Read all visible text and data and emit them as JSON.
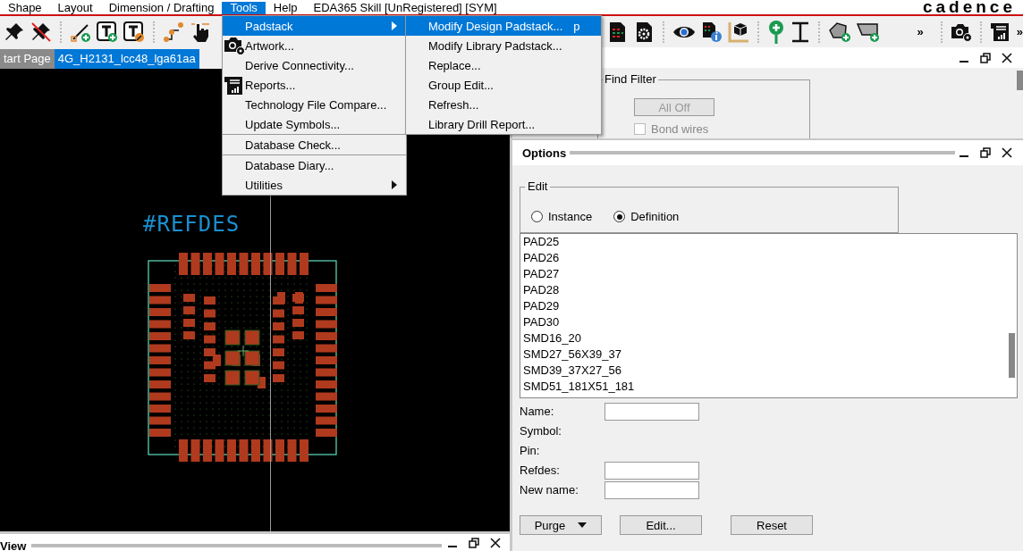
{
  "menubar": {
    "items": [
      {
        "label": "Shape",
        "selected": false
      },
      {
        "label": "Layout",
        "selected": false
      },
      {
        "label": "Dimension / Drafting",
        "selected": false
      },
      {
        "label": "Tools",
        "selected": true
      },
      {
        "label": "Help",
        "selected": false
      },
      {
        "label": "EDA365 Skill [UnRegistered] [SYM]",
        "selected": false
      }
    ],
    "logo": "cadence"
  },
  "toolbar": {
    "overflow": [
      "»",
      "»"
    ]
  },
  "tabs": [
    {
      "label": "tart Page",
      "selected": false
    },
    {
      "label": "4G_H2131_lcc48_lga61aa",
      "selected": true
    }
  ],
  "canvas": {
    "refdes": "#REFDES"
  },
  "tools_menu": {
    "items": [
      {
        "label": "Padstack",
        "kind": "plain",
        "selected": true,
        "submenu": true,
        "separator_before": false
      },
      {
        "label": "Artwork...",
        "kind": "camera",
        "selected": false,
        "submenu": false,
        "separator_before": false
      },
      {
        "label": "Derive Connectivity...",
        "kind": "plain",
        "selected": false,
        "submenu": false,
        "separator_before": false
      },
      {
        "label": "Reports...",
        "kind": "report",
        "selected": false,
        "submenu": false,
        "separator_before": false
      },
      {
        "label": "Technology File Compare...",
        "kind": "plain",
        "selected": false,
        "submenu": false,
        "separator_before": false
      },
      {
        "label": "Update Symbols...",
        "kind": "plain",
        "selected": false,
        "submenu": false,
        "separator_before": false
      },
      {
        "label": "Database Check...",
        "kind": "plain",
        "selected": false,
        "submenu": false,
        "separator_before": true
      },
      {
        "label": "Database Diary...",
        "kind": "plain",
        "selected": false,
        "submenu": false,
        "separator_before": true
      },
      {
        "label": "Utilities",
        "kind": "plain",
        "selected": false,
        "submenu": true,
        "separator_before": false
      }
    ]
  },
  "padstack_menu": {
    "items": [
      {
        "label": "Modify Design Padstack...",
        "shortcut": "p",
        "selected": true
      },
      {
        "label": "Modify Library Padstack...",
        "selected": false
      },
      {
        "label": "Replace...",
        "selected": false
      },
      {
        "label": "Group Edit...",
        "selected": false
      },
      {
        "label": "Refresh...",
        "selected": false
      },
      {
        "label": "Library Drill Report...",
        "selected": false
      }
    ]
  },
  "find_panel": {
    "group_title": "Find Filter",
    "all_off": {
      "label": "All Off",
      "disabled": true
    },
    "checkbox": {
      "label": "Bond wires",
      "checked": false,
      "disabled": true
    }
  },
  "options_panel": {
    "title": "Options",
    "edit_group": {
      "title": "Edit",
      "options": [
        {
          "label": "Instance",
          "selected": false
        },
        {
          "label": "Definition",
          "selected": true
        }
      ]
    },
    "list": [
      {
        "label": "PAD25"
      },
      {
        "label": "PAD26"
      },
      {
        "label": "PAD27"
      },
      {
        "label": "PAD28"
      },
      {
        "label": "PAD29"
      },
      {
        "label": "PAD30"
      },
      {
        "label": "SMD16_20"
      },
      {
        "label": "SMD27_56X39_37"
      },
      {
        "label": "SMD39_37X27_56"
      },
      {
        "label": "SMD51_181X51_181"
      }
    ],
    "fields": [
      {
        "label": "Name:",
        "kind": "input"
      },
      {
        "label": "Symbol:",
        "kind": "text"
      },
      {
        "label": "Pin:",
        "kind": "text"
      },
      {
        "label": "Refdes:",
        "kind": "input"
      },
      {
        "label": "New name:",
        "kind": "input"
      }
    ],
    "buttons": [
      {
        "label": "Purge",
        "kind": "dropdown"
      },
      {
        "label": "Edit...",
        "kind": "plain"
      },
      {
        "label": "Reset",
        "kind": "plain"
      }
    ]
  },
  "view_panel": {
    "title": "View"
  }
}
